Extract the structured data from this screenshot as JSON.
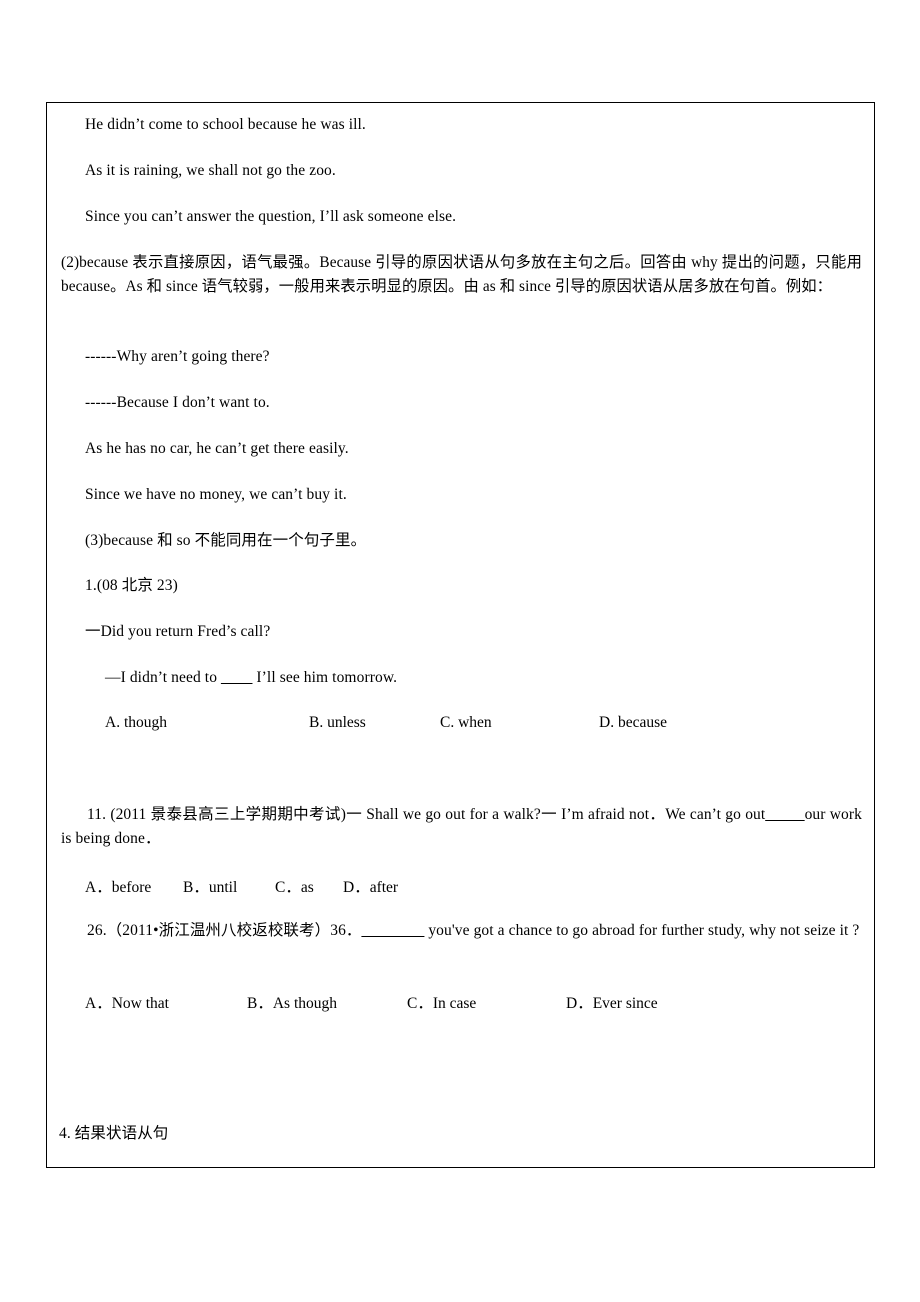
{
  "document": {
    "examples_group_1": [
      {
        "id": "ex1",
        "text": "He didn’t come to school because he was ill."
      },
      {
        "id": "ex2",
        "text": "As it is raining, we shall not go the zoo."
      },
      {
        "id": "ex3",
        "text": "Since you can’t answer the question, I’ll ask someone else."
      }
    ],
    "explanation_2": "(2)because 表示直接原因，语气最强。Because 引导的原因状语从句多放在主句之后。回答由 why 提出的问题，只能用 because。As 和 since 语气较弱，一般用来表示明显的原因。由 as 和 since 引导的原因状语从居多放在句首。例如：",
    "examples_group_2": [
      {
        "id": "ex4",
        "text": "------Why aren’t going there?"
      },
      {
        "id": "ex5",
        "text": "------Because I don’t want to."
      },
      {
        "id": "ex6",
        "text": "As he has no car, he can’t get there easily."
      },
      {
        "id": "ex7",
        "text": "Since we have no money, we can’t buy it."
      }
    ],
    "explanation_3": "(3)because 和 so 不能同用在一个句子里。",
    "question_1": {
      "source": "1.(08 北京 23)",
      "prompt_line_1": "一Did you return Fred’s call?",
      "prompt_line_2_before": "—I didn’t need to ",
      "prompt_line_2_blank": "____",
      "prompt_line_2_after": "  I’ll see him tomorrow.",
      "options": [
        {
          "label": "A. though"
        },
        {
          "label": "B. unless"
        },
        {
          "label": "C. when"
        },
        {
          "label": "D. because"
        }
      ]
    },
    "question_11": {
      "stem_before_blank": "11. (2011 景泰县高三上学期期中考试)一 Shall we go out for a walk?一 I’m afraid not．We can’t go out",
      "stem_blank": "_____",
      "stem_after_blank": "our work is being done．",
      "options": [
        {
          "label": "A．before"
        },
        {
          "label": "B．until"
        },
        {
          "label": "C．as"
        },
        {
          "label": "D．after"
        }
      ]
    },
    "question_26": {
      "stem_before_blank": "26.（2011•浙江温州八校返校联考）36．",
      "stem_blank": "________",
      "stem_after_blank": " you've got a chance to go abroad for further study, why not seize it ?",
      "options": [
        {
          "label": "A．Now that"
        },
        {
          "label": "B．As though"
        },
        {
          "label": "C．In case"
        },
        {
          "label": "D．Ever since"
        }
      ]
    },
    "section_heading_4": "4. 结果状语从句"
  }
}
